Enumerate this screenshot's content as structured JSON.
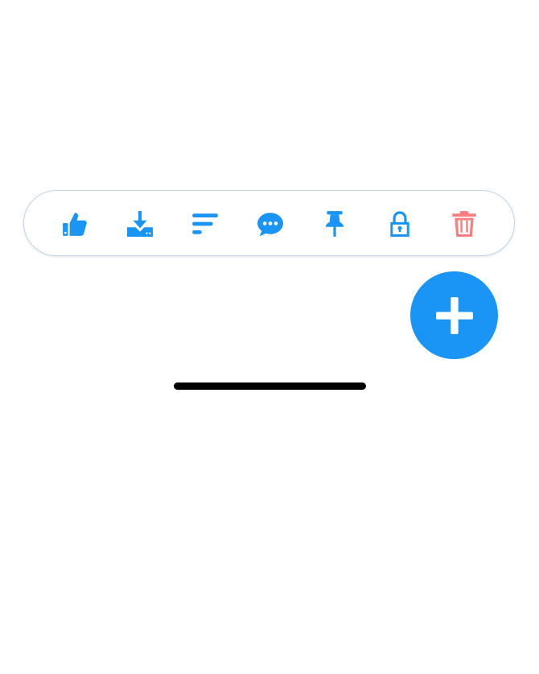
{
  "colors": {
    "accent": "#1a95f5",
    "danger": "#f77f7f",
    "toolbar_border": "#c3d6e8",
    "home_indicator": "#000000",
    "background": "#ffffff"
  },
  "toolbar": {
    "items": [
      {
        "id": "like",
        "icon": "thumbs-up-icon"
      },
      {
        "id": "download",
        "icon": "download-icon"
      },
      {
        "id": "sort",
        "icon": "sort-lines-icon"
      },
      {
        "id": "comment",
        "icon": "chat-bubble-icon"
      },
      {
        "id": "pin",
        "icon": "pin-icon"
      },
      {
        "id": "lock",
        "icon": "lock-icon"
      },
      {
        "id": "delete",
        "icon": "trash-icon"
      }
    ]
  },
  "fab": {
    "icon": "plus-icon"
  }
}
